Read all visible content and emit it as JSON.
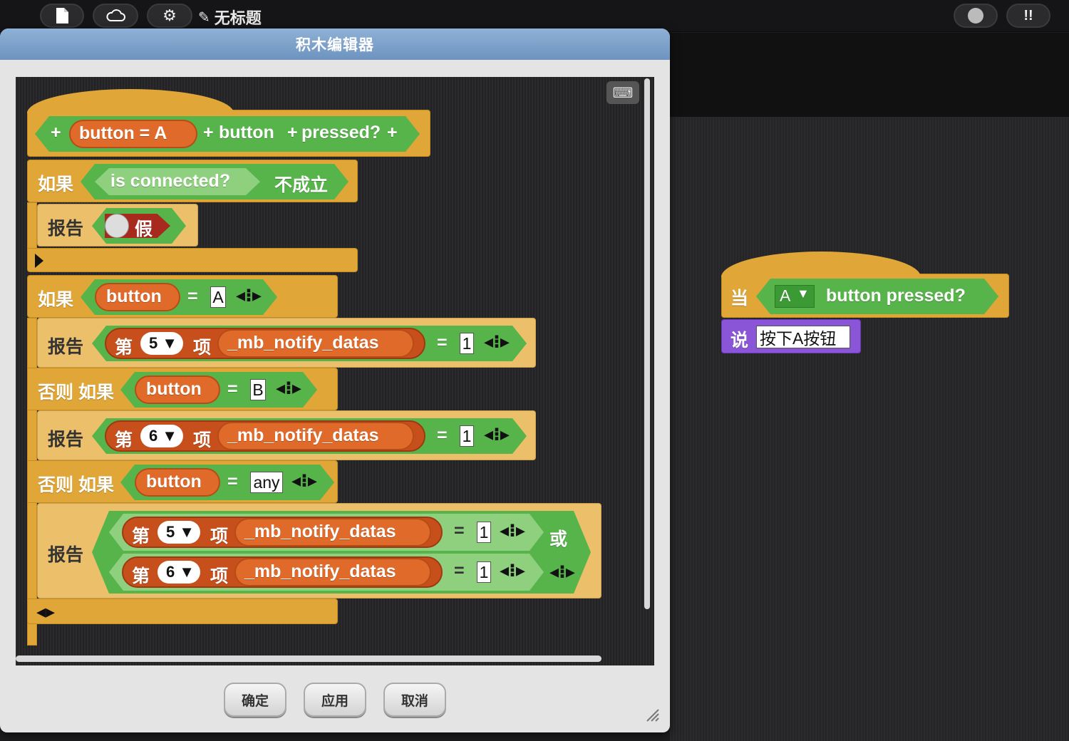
{
  "topbar": {
    "project_title": "无标题",
    "icons": [
      "file-icon",
      "cloud-icon",
      "gear-icon",
      "pencil-icon",
      "record-icon",
      "steps-icon"
    ]
  },
  "dialog": {
    "title": "积木编辑器",
    "buttons": {
      "ok": "确定",
      "apply": "应用",
      "cancel": "取消"
    }
  },
  "editor": {
    "hat": {
      "param_a": "button = A",
      "label_button": "button",
      "label_pressed": "pressed?"
    },
    "if1": {
      "keyword": "如果",
      "pred": "is connected?",
      "suffix": "不成立"
    },
    "report1": {
      "keyword": "报告",
      "value": "假"
    },
    "if2": {
      "keyword": "如果",
      "var": "button",
      "eq": "=",
      "value": "A"
    },
    "report2": {
      "keyword": "报告",
      "item": "第",
      "index": "5",
      "of": "项",
      "list": "_mb_notify_datas",
      "eq": "=",
      "value": "1"
    },
    "elif1": {
      "keyword": "否则 如果",
      "var": "button",
      "eq": "=",
      "value": "B"
    },
    "report3": {
      "keyword": "报告",
      "item": "第",
      "index": "6",
      "of": "项",
      "list": "_mb_notify_datas",
      "eq": "=",
      "value": "1"
    },
    "elif2": {
      "keyword": "否则 如果",
      "var": "button",
      "eq": "=",
      "value": "any"
    },
    "report4": {
      "keyword": "报告",
      "row1": {
        "item": "第",
        "index": "5",
        "of": "项",
        "list": "_mb_notify_datas",
        "eq": "=",
        "value": "1"
      },
      "row2": {
        "item": "第",
        "index": "6",
        "of": "项",
        "list": "_mb_notify_datas",
        "eq": "=",
        "value": "1"
      },
      "or": "或"
    }
  },
  "script": {
    "hat": {
      "when": "当",
      "key": "A",
      "label": "button  pressed?"
    },
    "say": {
      "keyword": "说",
      "value": "按下A按钮"
    }
  }
}
